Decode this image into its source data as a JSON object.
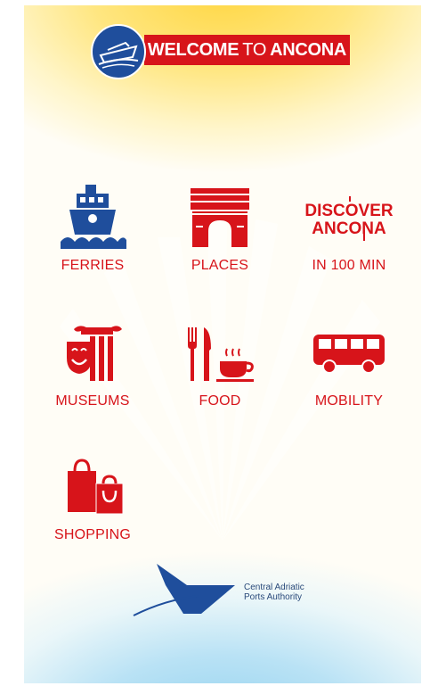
{
  "header": {
    "welcome_bold": "WELCOME",
    "welcome_light": "TO",
    "welcome_city": "ANCONA"
  },
  "tiles": [
    {
      "label": "FERRIES",
      "icon": "ferry-icon"
    },
    {
      "label": "PLACES",
      "icon": "arch-icon"
    },
    {
      "label": "IN 100 MIN",
      "icon": "discover-ancona-logo",
      "logo_text_1": "DISCOVER",
      "logo_text_2": "ANCONA"
    },
    {
      "label": "MUSEUMS",
      "icon": "museum-mask-icon"
    },
    {
      "label": "FOOD",
      "icon": "cutlery-coffee-icon"
    },
    {
      "label": "MOBILITY",
      "icon": "bus-icon"
    },
    {
      "label": "SHOPPING",
      "icon": "shopping-bags-icon"
    }
  ],
  "footer": {
    "line1": "Central Adriatic",
    "line2": "Ports Authority"
  },
  "colors": {
    "accent": "#d7141a",
    "brand_blue": "#1f4e9c"
  }
}
